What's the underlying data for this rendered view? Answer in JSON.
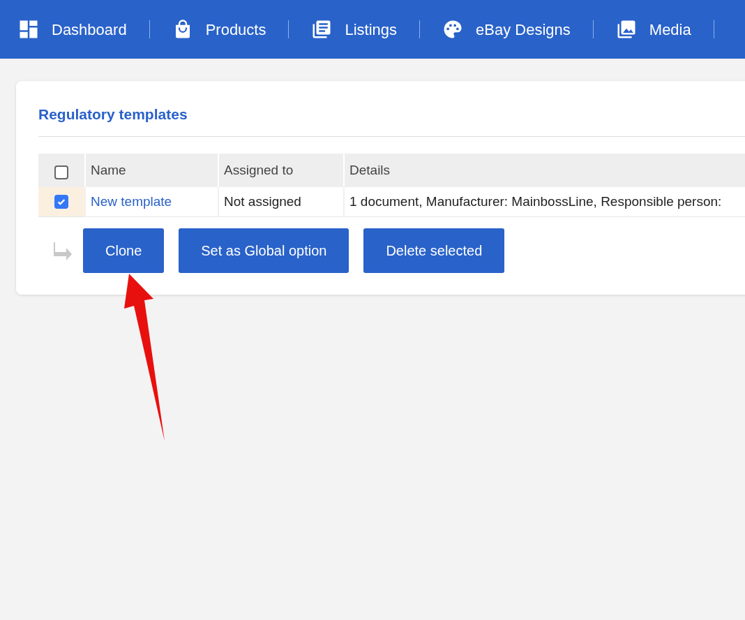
{
  "nav": {
    "items": [
      {
        "kind": "dashboard",
        "label": "Dashboard"
      },
      {
        "kind": "products",
        "label": "Products"
      },
      {
        "kind": "listings",
        "label": "Listings"
      },
      {
        "kind": "designs",
        "label": "eBay Designs"
      },
      {
        "kind": "media",
        "label": "Media"
      }
    ]
  },
  "card": {
    "title": "Regulatory templates",
    "table": {
      "select_all_checked": false,
      "columns": [
        "Name",
        "Assigned to",
        "Details"
      ],
      "rows": [
        {
          "checked": true,
          "name": "New template",
          "assigned_to": "Not assigned",
          "details": "1 document, Manufacturer: MainbossLine, Responsible person:"
        }
      ]
    },
    "buttons": [
      "Clone",
      "Set as Global option",
      "Delete selected"
    ]
  }
}
